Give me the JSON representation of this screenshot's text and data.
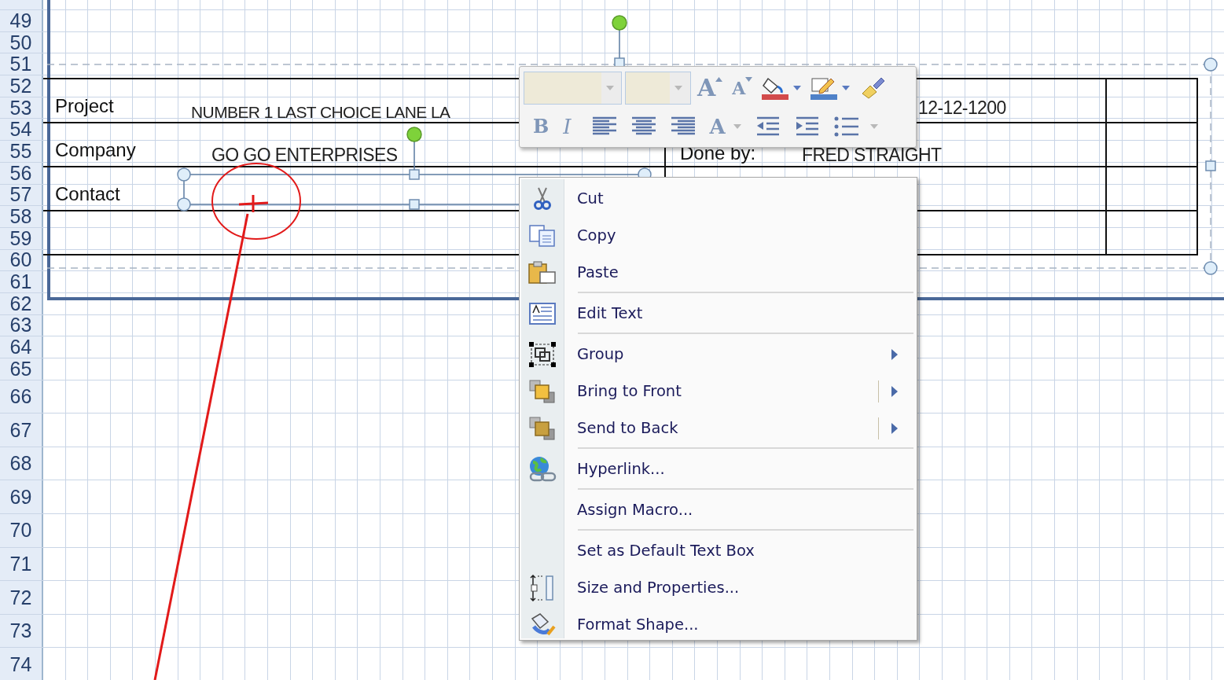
{
  "row_headers": [
    "49",
    "50",
    "51",
    "52",
    "53",
    "54",
    "55",
    "56",
    "57",
    "58",
    "59",
    "60",
    "61",
    "62",
    "63",
    "64",
    "65",
    "66",
    "67",
    "68",
    "69",
    "70",
    "71",
    "72",
    "73",
    "74"
  ],
  "form": {
    "labels": [
      "Project",
      "Company",
      "Contact"
    ],
    "project_value": "NUMBER 1 LAST CHOICE LANE LA",
    "company_value": "GO GO ENTERPRISES",
    "date_value": "12-12-1200",
    "done_by_label": "Done by:",
    "done_by_value": "FRED STRAIGHT"
  },
  "mini_toolbar": {
    "rows": [
      [
        {
          "kind": "font-name"
        },
        {
          "kind": "font-size"
        },
        {
          "kind": "grow-font",
          "glyph": "A"
        },
        {
          "kind": "shrink-font",
          "glyph": "A"
        },
        {
          "kind": "fill-color",
          "color": "#d24b4b"
        },
        {
          "kind": "line-color",
          "color": "#4f81c8"
        },
        {
          "kind": "format-painter"
        }
      ],
      [
        {
          "kind": "bold",
          "glyph": "B"
        },
        {
          "kind": "italic",
          "glyph": "I"
        },
        {
          "kind": "align-left"
        },
        {
          "kind": "align-center"
        },
        {
          "kind": "align-right"
        },
        {
          "kind": "font-color",
          "glyph": "A"
        },
        {
          "kind": "outdent"
        },
        {
          "kind": "indent"
        },
        {
          "kind": "bullets"
        }
      ]
    ]
  },
  "context_menu": [
    {
      "label": "Cut",
      "separator_before": false,
      "submenu": false,
      "split": false
    },
    {
      "label": "Copy",
      "separator_before": false,
      "submenu": false,
      "split": false
    },
    {
      "label": "Paste",
      "separator_before": false,
      "submenu": false,
      "split": false
    },
    {
      "label": "Edit Text",
      "separator_before": true,
      "submenu": false,
      "split": false
    },
    {
      "label": "Group",
      "separator_before": true,
      "submenu": true,
      "split": false
    },
    {
      "label": "Bring to Front",
      "separator_before": false,
      "submenu": true,
      "split": true
    },
    {
      "label": "Send to Back",
      "separator_before": false,
      "submenu": true,
      "split": true
    },
    {
      "label": "Hyperlink...",
      "separator_before": true,
      "submenu": false,
      "split": false
    },
    {
      "label": "Assign Macro...",
      "separator_before": true,
      "submenu": false,
      "split": false
    },
    {
      "label": "Set as Default Text Box",
      "separator_before": true,
      "submenu": false,
      "split": false
    },
    {
      "label": "Size and Properties...",
      "separator_before": false,
      "submenu": false,
      "split": false
    },
    {
      "label": "Format Shape...",
      "separator_before": false,
      "submenu": false,
      "split": false
    }
  ]
}
